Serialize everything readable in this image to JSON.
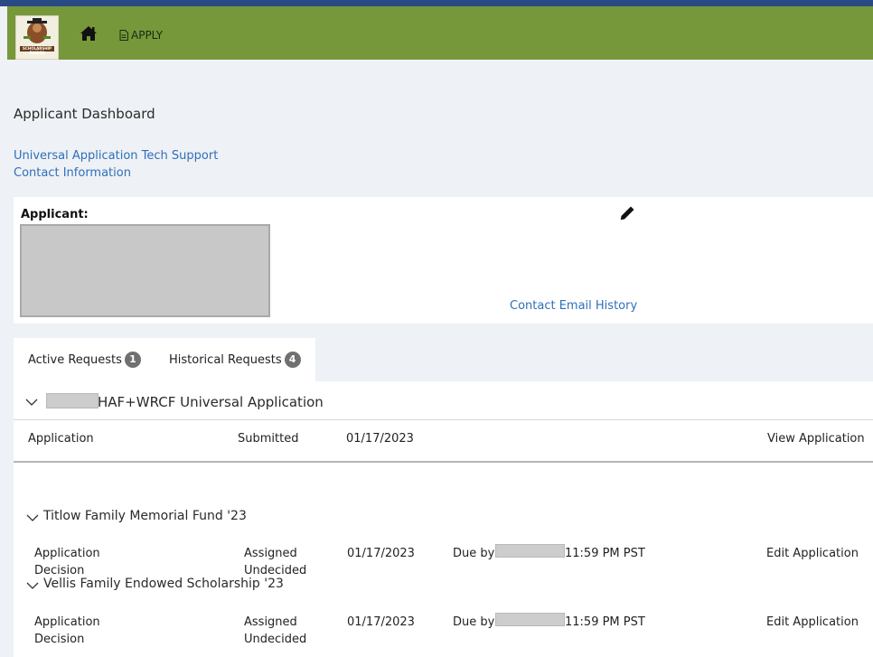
{
  "nav": {
    "logo_text": "SCHOLARSHIP FINDER",
    "apply_label": "APPLY"
  },
  "page": {
    "title": "Applicant Dashboard",
    "help_links": [
      "Universal Application Tech Support",
      "Contact Information"
    ]
  },
  "applicant_card": {
    "label": "Applicant:",
    "contact_email_history": "Contact Email History"
  },
  "tabs": [
    {
      "label": "Active Requests",
      "count": "1"
    },
    {
      "label": "Historical Requests",
      "count": "4"
    }
  ],
  "requests": {
    "main_title": "HAF+WRCF Universal Application",
    "main_row": {
      "type": "Application",
      "status": "Submitted",
      "date": "01/17/2023",
      "action": "View Application"
    },
    "sub_requests": [
      {
        "title": "Titlow Family Memorial Fund '23",
        "types": [
          "Application",
          "Decision"
        ],
        "statuses": [
          "Assigned",
          "Undecided"
        ],
        "date": "01/17/2023",
        "due_prefix": "Due by",
        "due_time": "11:59 PM PST",
        "action": "Edit Application"
      },
      {
        "title": "Vellis Family Endowed Scholarship '23",
        "types": [
          "Application",
          "Decision"
        ],
        "statuses": [
          "Assigned",
          "Undecided"
        ],
        "date": "01/17/2023",
        "due_prefix": "Due by",
        "due_time": "11:59 PM PST",
        "action": "Edit Application"
      }
    ]
  },
  "colors": {
    "nav_green": "#76983b",
    "link_blue": "#2f6fba",
    "badge_gray": "#707070",
    "top_strip": "#2a4a86"
  }
}
